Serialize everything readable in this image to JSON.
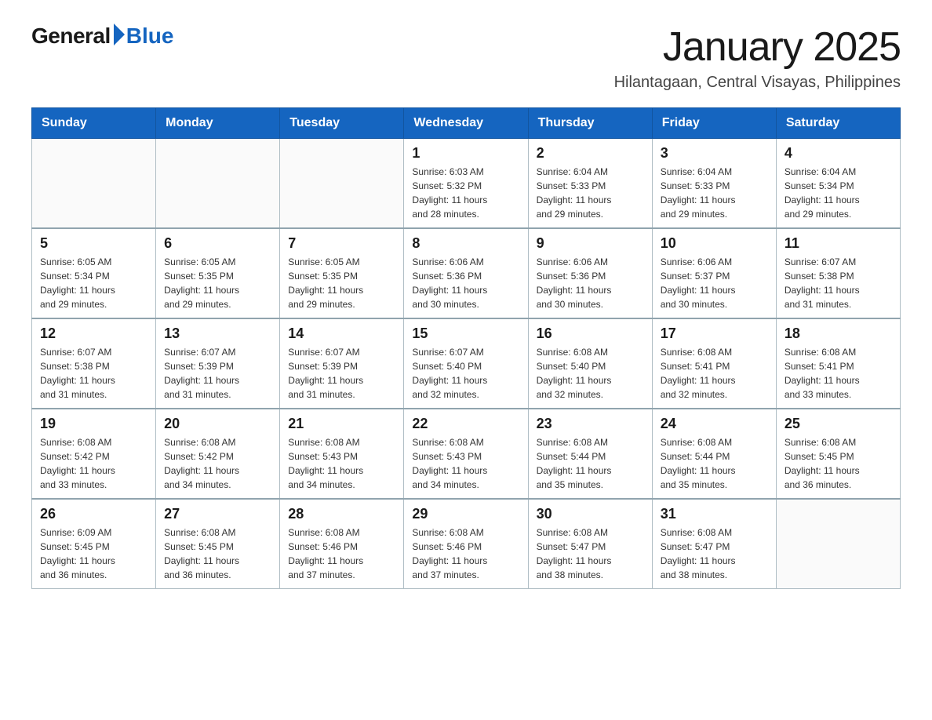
{
  "header": {
    "logo_general": "General",
    "logo_blue": "Blue",
    "month_title": "January 2025",
    "subtitle": "Hilantagaan, Central Visayas, Philippines"
  },
  "days_of_week": [
    "Sunday",
    "Monday",
    "Tuesday",
    "Wednesday",
    "Thursday",
    "Friday",
    "Saturday"
  ],
  "weeks": [
    [
      {
        "day": "",
        "info": ""
      },
      {
        "day": "",
        "info": ""
      },
      {
        "day": "",
        "info": ""
      },
      {
        "day": "1",
        "info": "Sunrise: 6:03 AM\nSunset: 5:32 PM\nDaylight: 11 hours\nand 28 minutes."
      },
      {
        "day": "2",
        "info": "Sunrise: 6:04 AM\nSunset: 5:33 PM\nDaylight: 11 hours\nand 29 minutes."
      },
      {
        "day": "3",
        "info": "Sunrise: 6:04 AM\nSunset: 5:33 PM\nDaylight: 11 hours\nand 29 minutes."
      },
      {
        "day": "4",
        "info": "Sunrise: 6:04 AM\nSunset: 5:34 PM\nDaylight: 11 hours\nand 29 minutes."
      }
    ],
    [
      {
        "day": "5",
        "info": "Sunrise: 6:05 AM\nSunset: 5:34 PM\nDaylight: 11 hours\nand 29 minutes."
      },
      {
        "day": "6",
        "info": "Sunrise: 6:05 AM\nSunset: 5:35 PM\nDaylight: 11 hours\nand 29 minutes."
      },
      {
        "day": "7",
        "info": "Sunrise: 6:05 AM\nSunset: 5:35 PM\nDaylight: 11 hours\nand 29 minutes."
      },
      {
        "day": "8",
        "info": "Sunrise: 6:06 AM\nSunset: 5:36 PM\nDaylight: 11 hours\nand 30 minutes."
      },
      {
        "day": "9",
        "info": "Sunrise: 6:06 AM\nSunset: 5:36 PM\nDaylight: 11 hours\nand 30 minutes."
      },
      {
        "day": "10",
        "info": "Sunrise: 6:06 AM\nSunset: 5:37 PM\nDaylight: 11 hours\nand 30 minutes."
      },
      {
        "day": "11",
        "info": "Sunrise: 6:07 AM\nSunset: 5:38 PM\nDaylight: 11 hours\nand 31 minutes."
      }
    ],
    [
      {
        "day": "12",
        "info": "Sunrise: 6:07 AM\nSunset: 5:38 PM\nDaylight: 11 hours\nand 31 minutes."
      },
      {
        "day": "13",
        "info": "Sunrise: 6:07 AM\nSunset: 5:39 PM\nDaylight: 11 hours\nand 31 minutes."
      },
      {
        "day": "14",
        "info": "Sunrise: 6:07 AM\nSunset: 5:39 PM\nDaylight: 11 hours\nand 31 minutes."
      },
      {
        "day": "15",
        "info": "Sunrise: 6:07 AM\nSunset: 5:40 PM\nDaylight: 11 hours\nand 32 minutes."
      },
      {
        "day": "16",
        "info": "Sunrise: 6:08 AM\nSunset: 5:40 PM\nDaylight: 11 hours\nand 32 minutes."
      },
      {
        "day": "17",
        "info": "Sunrise: 6:08 AM\nSunset: 5:41 PM\nDaylight: 11 hours\nand 32 minutes."
      },
      {
        "day": "18",
        "info": "Sunrise: 6:08 AM\nSunset: 5:41 PM\nDaylight: 11 hours\nand 33 minutes."
      }
    ],
    [
      {
        "day": "19",
        "info": "Sunrise: 6:08 AM\nSunset: 5:42 PM\nDaylight: 11 hours\nand 33 minutes."
      },
      {
        "day": "20",
        "info": "Sunrise: 6:08 AM\nSunset: 5:42 PM\nDaylight: 11 hours\nand 34 minutes."
      },
      {
        "day": "21",
        "info": "Sunrise: 6:08 AM\nSunset: 5:43 PM\nDaylight: 11 hours\nand 34 minutes."
      },
      {
        "day": "22",
        "info": "Sunrise: 6:08 AM\nSunset: 5:43 PM\nDaylight: 11 hours\nand 34 minutes."
      },
      {
        "day": "23",
        "info": "Sunrise: 6:08 AM\nSunset: 5:44 PM\nDaylight: 11 hours\nand 35 minutes."
      },
      {
        "day": "24",
        "info": "Sunrise: 6:08 AM\nSunset: 5:44 PM\nDaylight: 11 hours\nand 35 minutes."
      },
      {
        "day": "25",
        "info": "Sunrise: 6:08 AM\nSunset: 5:45 PM\nDaylight: 11 hours\nand 36 minutes."
      }
    ],
    [
      {
        "day": "26",
        "info": "Sunrise: 6:09 AM\nSunset: 5:45 PM\nDaylight: 11 hours\nand 36 minutes."
      },
      {
        "day": "27",
        "info": "Sunrise: 6:08 AM\nSunset: 5:45 PM\nDaylight: 11 hours\nand 36 minutes."
      },
      {
        "day": "28",
        "info": "Sunrise: 6:08 AM\nSunset: 5:46 PM\nDaylight: 11 hours\nand 37 minutes."
      },
      {
        "day": "29",
        "info": "Sunrise: 6:08 AM\nSunset: 5:46 PM\nDaylight: 11 hours\nand 37 minutes."
      },
      {
        "day": "30",
        "info": "Sunrise: 6:08 AM\nSunset: 5:47 PM\nDaylight: 11 hours\nand 38 minutes."
      },
      {
        "day": "31",
        "info": "Sunrise: 6:08 AM\nSunset: 5:47 PM\nDaylight: 11 hours\nand 38 minutes."
      },
      {
        "day": "",
        "info": ""
      }
    ]
  ]
}
